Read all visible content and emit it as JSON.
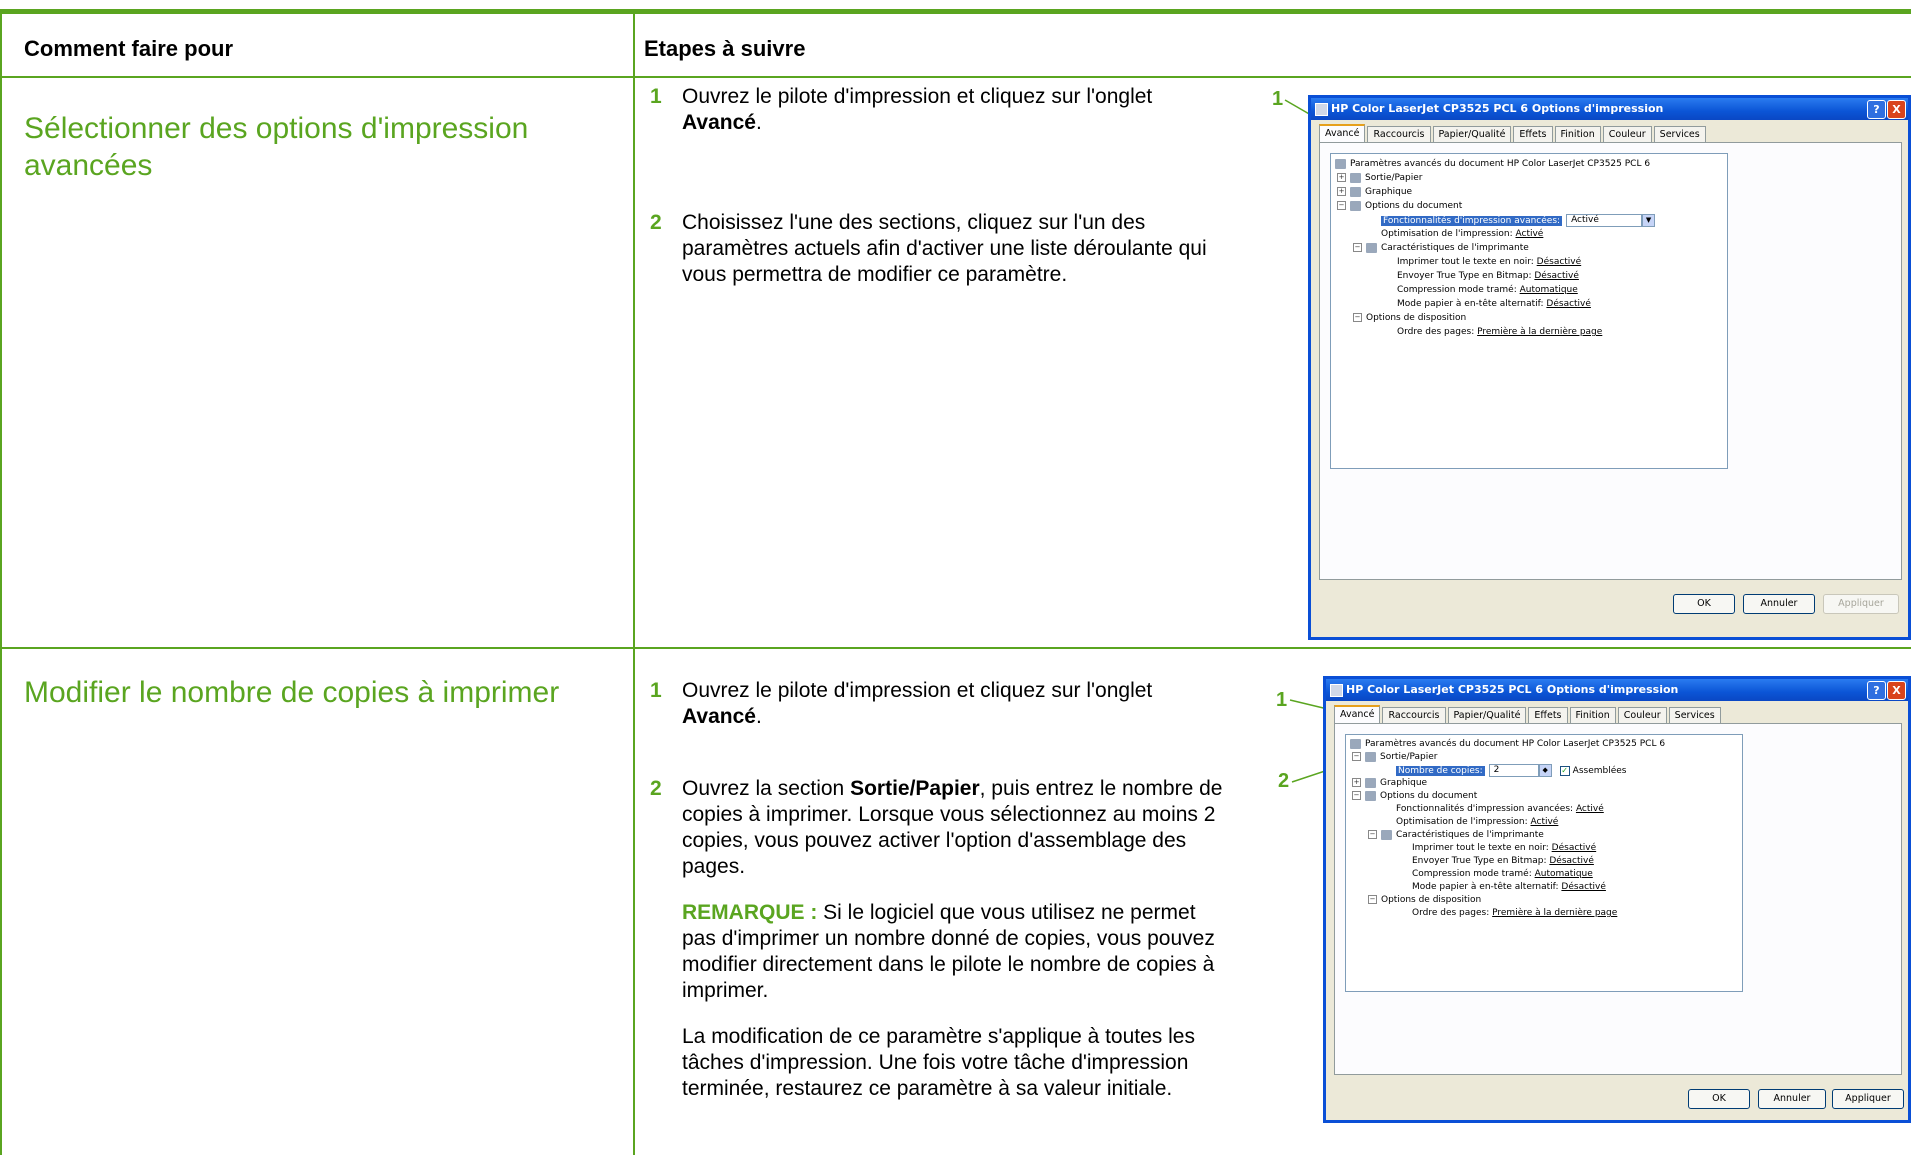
{
  "header": {
    "col1": "Comment faire pour",
    "col2": "Etapes à suivre"
  },
  "rows": [
    {
      "topic": "Sélectionner des options d'impression avancées",
      "steps": [
        {
          "num": "1",
          "text_before": "Ouvrez le pilote d'impression et cliquez sur l'onglet ",
          "bold": "Avancé",
          "text_after": "."
        },
        {
          "num": "2",
          "text": "Choisissez l'une des sections, cliquez sur l'un des paramètres actuels afin d'activer une liste déroulante qui vous permettra de modifier ce paramètre."
        }
      ],
      "callouts": [
        "1"
      ],
      "dialog": {
        "title": "HP Color LaserJet CP3525 PCL 6 Options d'impression",
        "help": "?",
        "close": "X",
        "tabs": [
          "Avancé",
          "Raccourcis",
          "Papier/Qualité",
          "Effets",
          "Finition",
          "Couleur",
          "Services"
        ],
        "tree": {
          "root": "Paramètres avancés du document HP Color LaserJet CP3525 PCL 6",
          "output": "Sortie/Papier",
          "graphic": "Graphique",
          "doc_options": "Options du document",
          "advanced_features_label": "Fonctionnalités d'impression avancées:",
          "advanced_features_value": "Activé",
          "optimization_label": "Optimisation de l'impression:",
          "optimization_value": "Activé",
          "printer_features": "Caractéristiques de l'imprimante",
          "black_text_label": "Imprimer tout le texte en noir:",
          "black_text_value": "Désactivé",
          "truetype_label": "Envoyer True Type en Bitmap:",
          "truetype_value": "Désactivé",
          "halftone_label": "Compression mode tramé:",
          "halftone_value": "Automatique",
          "letterhead_label": "Mode papier à en-tête alternatif:",
          "letterhead_value": "Désactivé",
          "layout": "Options de disposition",
          "page_order_label": "Ordre des pages:",
          "page_order_value": "Première à la dernière page"
        },
        "buttons": {
          "ok": "OK",
          "cancel": "Annuler",
          "apply": "Appliquer"
        }
      }
    },
    {
      "topic": "Modifier le nombre de copies à imprimer",
      "steps": [
        {
          "num": "1",
          "text_before": "Ouvrez le pilote d'impression et cliquez sur l'onglet ",
          "bold": "Avancé",
          "text_after": "."
        },
        {
          "num": "2",
          "text_before": "Ouvrez la section ",
          "bold": "Sortie/Papier",
          "text_after": ", puis entrez le nombre de copies à imprimer. Lorsque vous sélectionnez au moins 2 copies, vous pouvez activer l'option d'assemblage des pages."
        }
      ],
      "note_label": "REMARQUE :",
      "note_text": " Si le logiciel que vous utilisez ne permet pas d'imprimer un nombre donné de copies, vous pouvez modifier directement dans le pilote le nombre de copies à imprimer.",
      "paragraph": "La modification de ce paramètre s'applique à toutes les tâches d'impression. Une fois votre tâche d'impression terminée, restaurez ce paramètre à sa valeur initiale.",
      "callouts": [
        "1",
        "2"
      ],
      "dialog": {
        "title": "HP Color LaserJet CP3525 PCL 6 Options d'impression",
        "help": "?",
        "close": "X",
        "tabs": [
          "Avancé",
          "Raccourcis",
          "Papier/Qualité",
          "Effets",
          "Finition",
          "Couleur",
          "Services"
        ],
        "tree": {
          "root": "Paramètres avancés du document HP Color LaserJet CP3525 PCL 6",
          "output": "Sortie/Papier",
          "copies_label": "Nombre de copies:",
          "copies_value": "2",
          "collated": "Assemblées",
          "graphic": "Graphique",
          "doc_options": "Options du document",
          "advanced_features_label": "Fonctionnalités d'impression avancées:",
          "advanced_features_value": "Activé",
          "optimization_label": "Optimisation de l'impression:",
          "optimization_value": "Activé",
          "printer_features": "Caractéristiques de l'imprimante",
          "black_text_label": "Imprimer tout le texte en noir:",
          "black_text_value": "Désactivé",
          "truetype_label": "Envoyer True Type en Bitmap:",
          "truetype_value": "Désactivé",
          "halftone_label": "Compression mode tramé:",
          "halftone_value": "Automatique",
          "letterhead_label": "Mode papier à en-tête alternatif:",
          "letterhead_value": "Désactivé",
          "layout": "Options de disposition",
          "page_order_label": "Ordre des pages:",
          "page_order_value": "Première à la dernière page"
        },
        "buttons": {
          "ok": "OK",
          "cancel": "Annuler",
          "apply": "Appliquer"
        }
      }
    }
  ]
}
